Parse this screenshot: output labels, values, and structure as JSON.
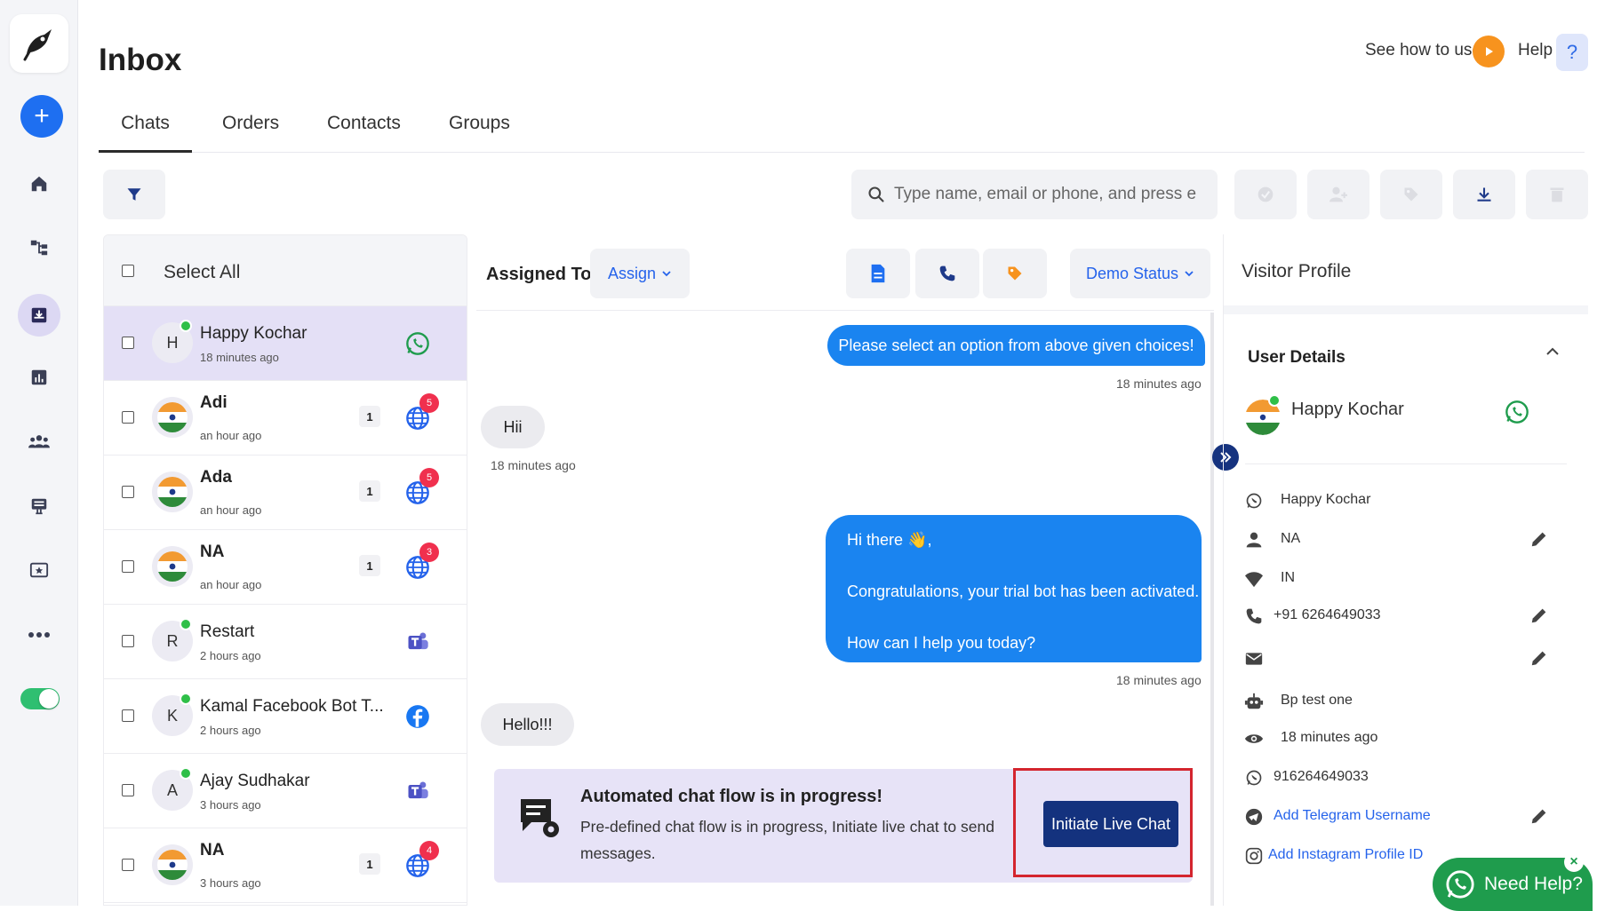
{
  "header": {
    "title": "Inbox",
    "see_how": "See how to use",
    "help": "Help",
    "help_glyph": "?"
  },
  "tabs": [
    {
      "label": "Chats",
      "active": true
    },
    {
      "label": "Orders"
    },
    {
      "label": "Contacts"
    },
    {
      "label": "Groups"
    }
  ],
  "toolbar": {
    "search_placeholder": "Type name, email or phone, and press enter"
  },
  "chat_list": {
    "select_all": "Select All",
    "rows": [
      {
        "avatar": "H",
        "name": "Happy Kochar",
        "time": "18 minutes ago",
        "channel": "whatsapp-icon",
        "online": true,
        "active": true
      },
      {
        "avatar": "flag",
        "name": "Adi",
        "time": "an hour ago",
        "count": "1",
        "channel": "web-globe-icon",
        "badge": "5"
      },
      {
        "avatar": "flag",
        "name": "Ada",
        "time": "an hour ago",
        "count": "1",
        "channel": "web-globe-icon",
        "badge": "5"
      },
      {
        "avatar": "flag",
        "name": "NA",
        "time": "an hour ago",
        "count": "1",
        "channel": "web-globe-icon",
        "badge": "3"
      },
      {
        "avatar": "R",
        "name": "Restart",
        "time": "2 hours ago",
        "channel": "teams-icon",
        "online": true
      },
      {
        "avatar": "K",
        "name": "Kamal Facebook Bot T...",
        "time": "2 hours ago",
        "channel": "facebook-icon",
        "online": true
      },
      {
        "avatar": "A",
        "name": "Ajay Sudhakar",
        "time": "3 hours ago",
        "channel": "teams-icon",
        "online": true
      },
      {
        "avatar": "flag",
        "name": "NA",
        "time": "3 hours ago",
        "count": "1",
        "channel": "web-globe-icon",
        "badge": "4"
      }
    ]
  },
  "conversation": {
    "assigned_to": "Assigned To",
    "assign": "Assign",
    "demo_status": "Demo Status",
    "messages": {
      "m1_text": "Please select an option from above given choices!",
      "m1_time": "18 minutes ago",
      "m2_text": "Hii",
      "m2_time": "18 minutes ago",
      "m3_line1": "Hi there 👋,",
      "m3_line2": "Congratulations, your trial bot has been activated.",
      "m3_line3": "How can I help you today?",
      "m3_time": "18 minutes ago",
      "m4_text": "Hello!!!"
    },
    "flow": {
      "title": "Automated chat flow is in progress!",
      "desc": "Pre-defined chat flow is in progress, Initiate live chat to send messages.",
      "button": "Initiate Live Chat"
    }
  },
  "profile": {
    "title": "Visitor Profile",
    "section": "User Details",
    "name": "Happy Kochar",
    "details": {
      "whatsapp_name": "Happy Kochar",
      "contact_name": "NA",
      "country": "IN",
      "phone": "+91 6264649033",
      "email": "",
      "bot": "Bp test one",
      "last_seen": "18 minutes ago",
      "whatsapp_number": "916264649033",
      "telegram": "Add Telegram Username",
      "instagram": "Add Instagram Profile ID"
    }
  },
  "widget": {
    "need_help": "Need Help?",
    "close": "×"
  },
  "colors": {
    "primary": "#1e6ff1",
    "bubble_out": "#1a84f0",
    "navy": "#14327e",
    "whatsapp": "#1f9c4d",
    "badge": "#f0304e"
  }
}
